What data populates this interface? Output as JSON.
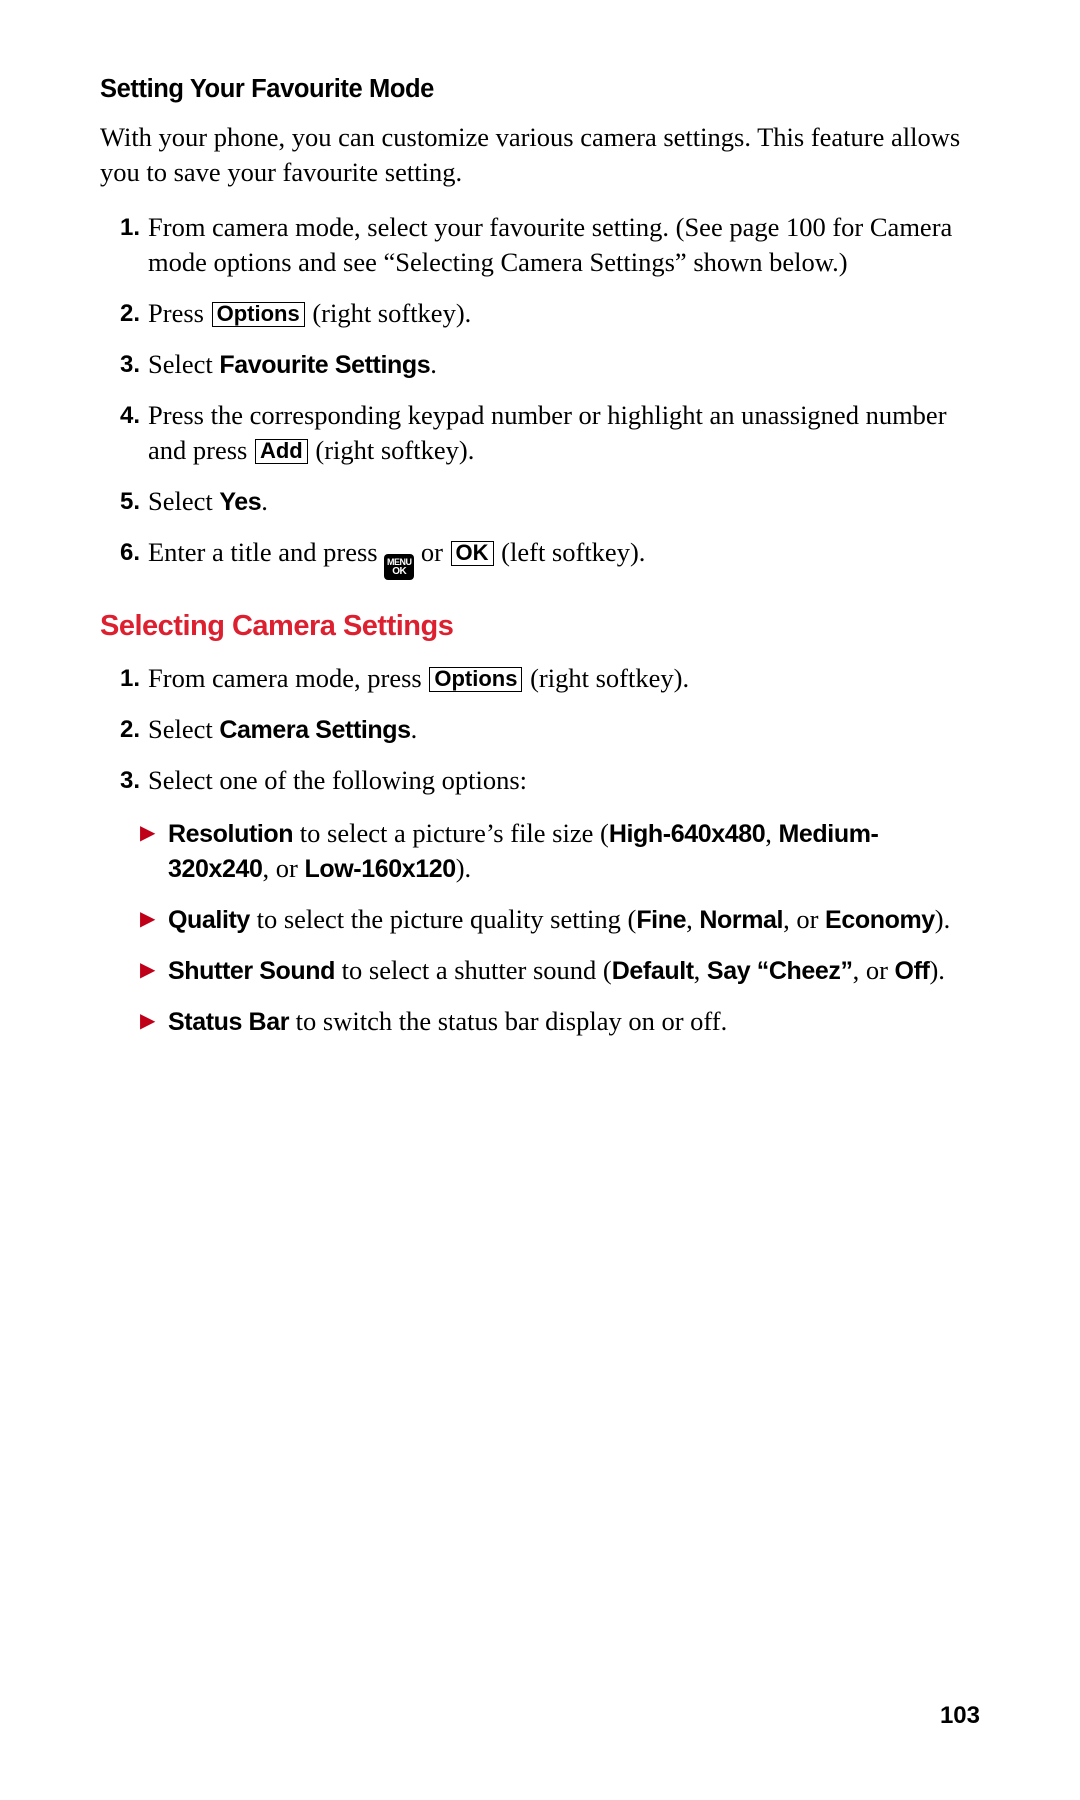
{
  "page_number": "103",
  "section1": {
    "title": "Setting Your Favourite Mode",
    "intro": "With your phone, you can customize various camera settings. This feature allows you to save your favourite setting.",
    "steps": [
      {
        "num": "1.",
        "text": "From camera mode, select your favourite setting. (See page 100 for Camera mode options and see “Selecting Camera Settings” shown below.)"
      },
      {
        "num": "2.",
        "pre": "Press ",
        "key": "Options",
        "post": " (right softkey)."
      },
      {
        "num": "3.",
        "pre": "Select ",
        "bold": "Favourite Settings",
        "post": "."
      },
      {
        "num": "4.",
        "pre": "Press the corresponding keypad number or highlight an unassigned number and press ",
        "key": "Add",
        "post": " (right softkey)."
      },
      {
        "num": "5.",
        "pre": "Select ",
        "bold": "Yes",
        "post": "."
      },
      {
        "num": "6.",
        "pre": "Enter a title and press ",
        "icon": {
          "line1": "MENU",
          "line2": "OK"
        },
        "mid": " or ",
        "key": "OK",
        "post": " (left softkey)."
      }
    ]
  },
  "section2": {
    "title": "Selecting Camera Settings",
    "steps": [
      {
        "num": "1.",
        "pre": "From camera mode, press ",
        "key": "Options",
        "post": " (right softkey)."
      },
      {
        "num": "2.",
        "pre": "Select ",
        "bold": "Camera Settings",
        "post": "."
      },
      {
        "num": "3.",
        "text": "Select one of the following options:"
      }
    ],
    "bullets": [
      {
        "bold1": "Resolution",
        "t1": " to select a picture’s file size (",
        "bold2": "High-640x480",
        "t2": ", ",
        "bold3": "Medium-320x240",
        "t3": ", or ",
        "bold4": "Low-160x120",
        "t4": ")."
      },
      {
        "bold1": "Quality",
        "t1": " to select the picture quality setting (",
        "bold2": "Fine",
        "t2": ", ",
        "bold3": "Normal",
        "t3": ", or ",
        "bold4": "Economy",
        "t4": ")."
      },
      {
        "bold1": "Shutter Sound",
        "t1": " to select a shutter sound (",
        "bold2": "Default",
        "t2": ", ",
        "bold3": "Say “Cheez”",
        "t3": ", or ",
        "bold4": "Off",
        "t4": ")."
      },
      {
        "bold1": "Status Bar",
        "t1": " to switch the status bar display on or off."
      }
    ]
  }
}
